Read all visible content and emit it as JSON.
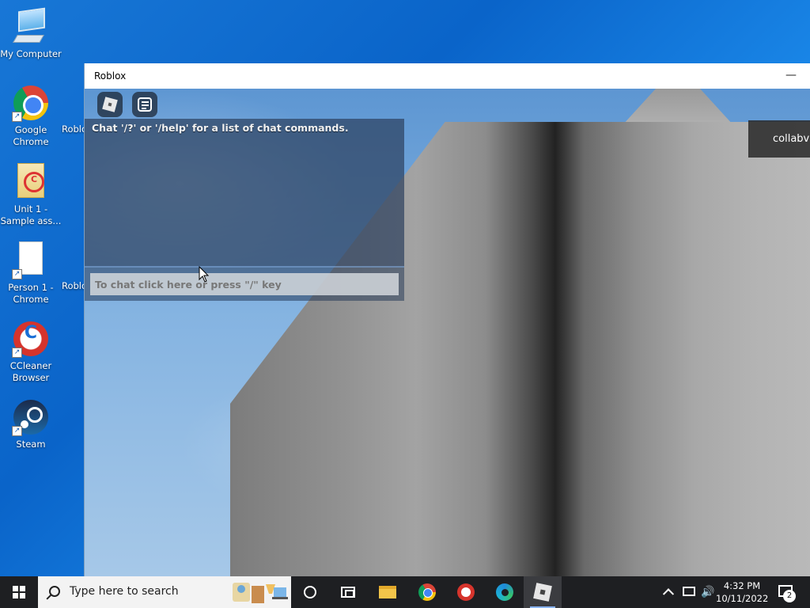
{
  "desktop": {
    "icons": [
      {
        "label": "My Computer",
        "icon": "computer-icon"
      },
      {
        "label": "Google Chrome",
        "icon": "chrome-icon"
      },
      {
        "label": "Unit 1 - Sample ass...",
        "icon": "document-folder-icon"
      },
      {
        "label": "Person 1 - Chrome",
        "icon": "blank-document-icon"
      },
      {
        "label": "CCleaner Browser",
        "icon": "ccleaner-icon"
      },
      {
        "label": "Steam",
        "icon": "steam-icon"
      },
      {
        "label": "Roblo",
        "icon": "roblox-icon"
      },
      {
        "label": "Roblo",
        "icon": "roblox-icon"
      }
    ]
  },
  "roblox_window": {
    "title": "Roblox",
    "minimize_glyph": "—",
    "chat": {
      "system_message": "Chat '/?' or '/help' for a list of chat commands.",
      "input_placeholder": "To chat click here or press \"/\" key"
    },
    "player_list_name": "collabv"
  },
  "taskbar": {
    "search_placeholder": "Type here to search",
    "apps": [
      "cortana-icon",
      "task-view-icon",
      "file-explorer-icon",
      "chrome-icon",
      "ccleaner-icon",
      "edge-icon",
      "roblox-icon"
    ],
    "active_app": "Roblox",
    "clock": {
      "time": "4:32 PM",
      "date": "10/11/2022"
    },
    "notification_count": "2",
    "volume_glyph": "🔊"
  },
  "colors": {
    "desktop_bg": "#0a64c9",
    "taskbar_bg": "#1e1f22",
    "chat_panel_bg": "#283c5a",
    "active_underline": "#8ab4f8"
  }
}
